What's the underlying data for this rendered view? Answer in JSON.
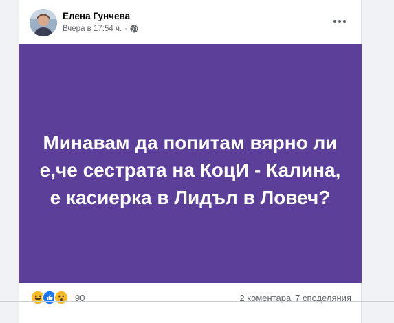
{
  "post": {
    "author": "Елена Гунчева",
    "timestamp": "Вчера в 17:54 ч.",
    "separator": "·",
    "privacy_icon": "globe-icon",
    "more_icon": "more-horizontal-icon",
    "background_color": "#5b3f99",
    "text_color": "#ffffff",
    "text": "Минавам да попитам вярно ли е,че сестрата на КоцИ - Калина, е касиерка в Лидъл в Ловеч?"
  },
  "footer": {
    "reactions": [
      "laugh-reaction-icon",
      "like-reaction-icon",
      "wow-reaction-icon"
    ],
    "reaction_count": "90",
    "comments": "2 коментара",
    "shares": "7 споделяния"
  }
}
